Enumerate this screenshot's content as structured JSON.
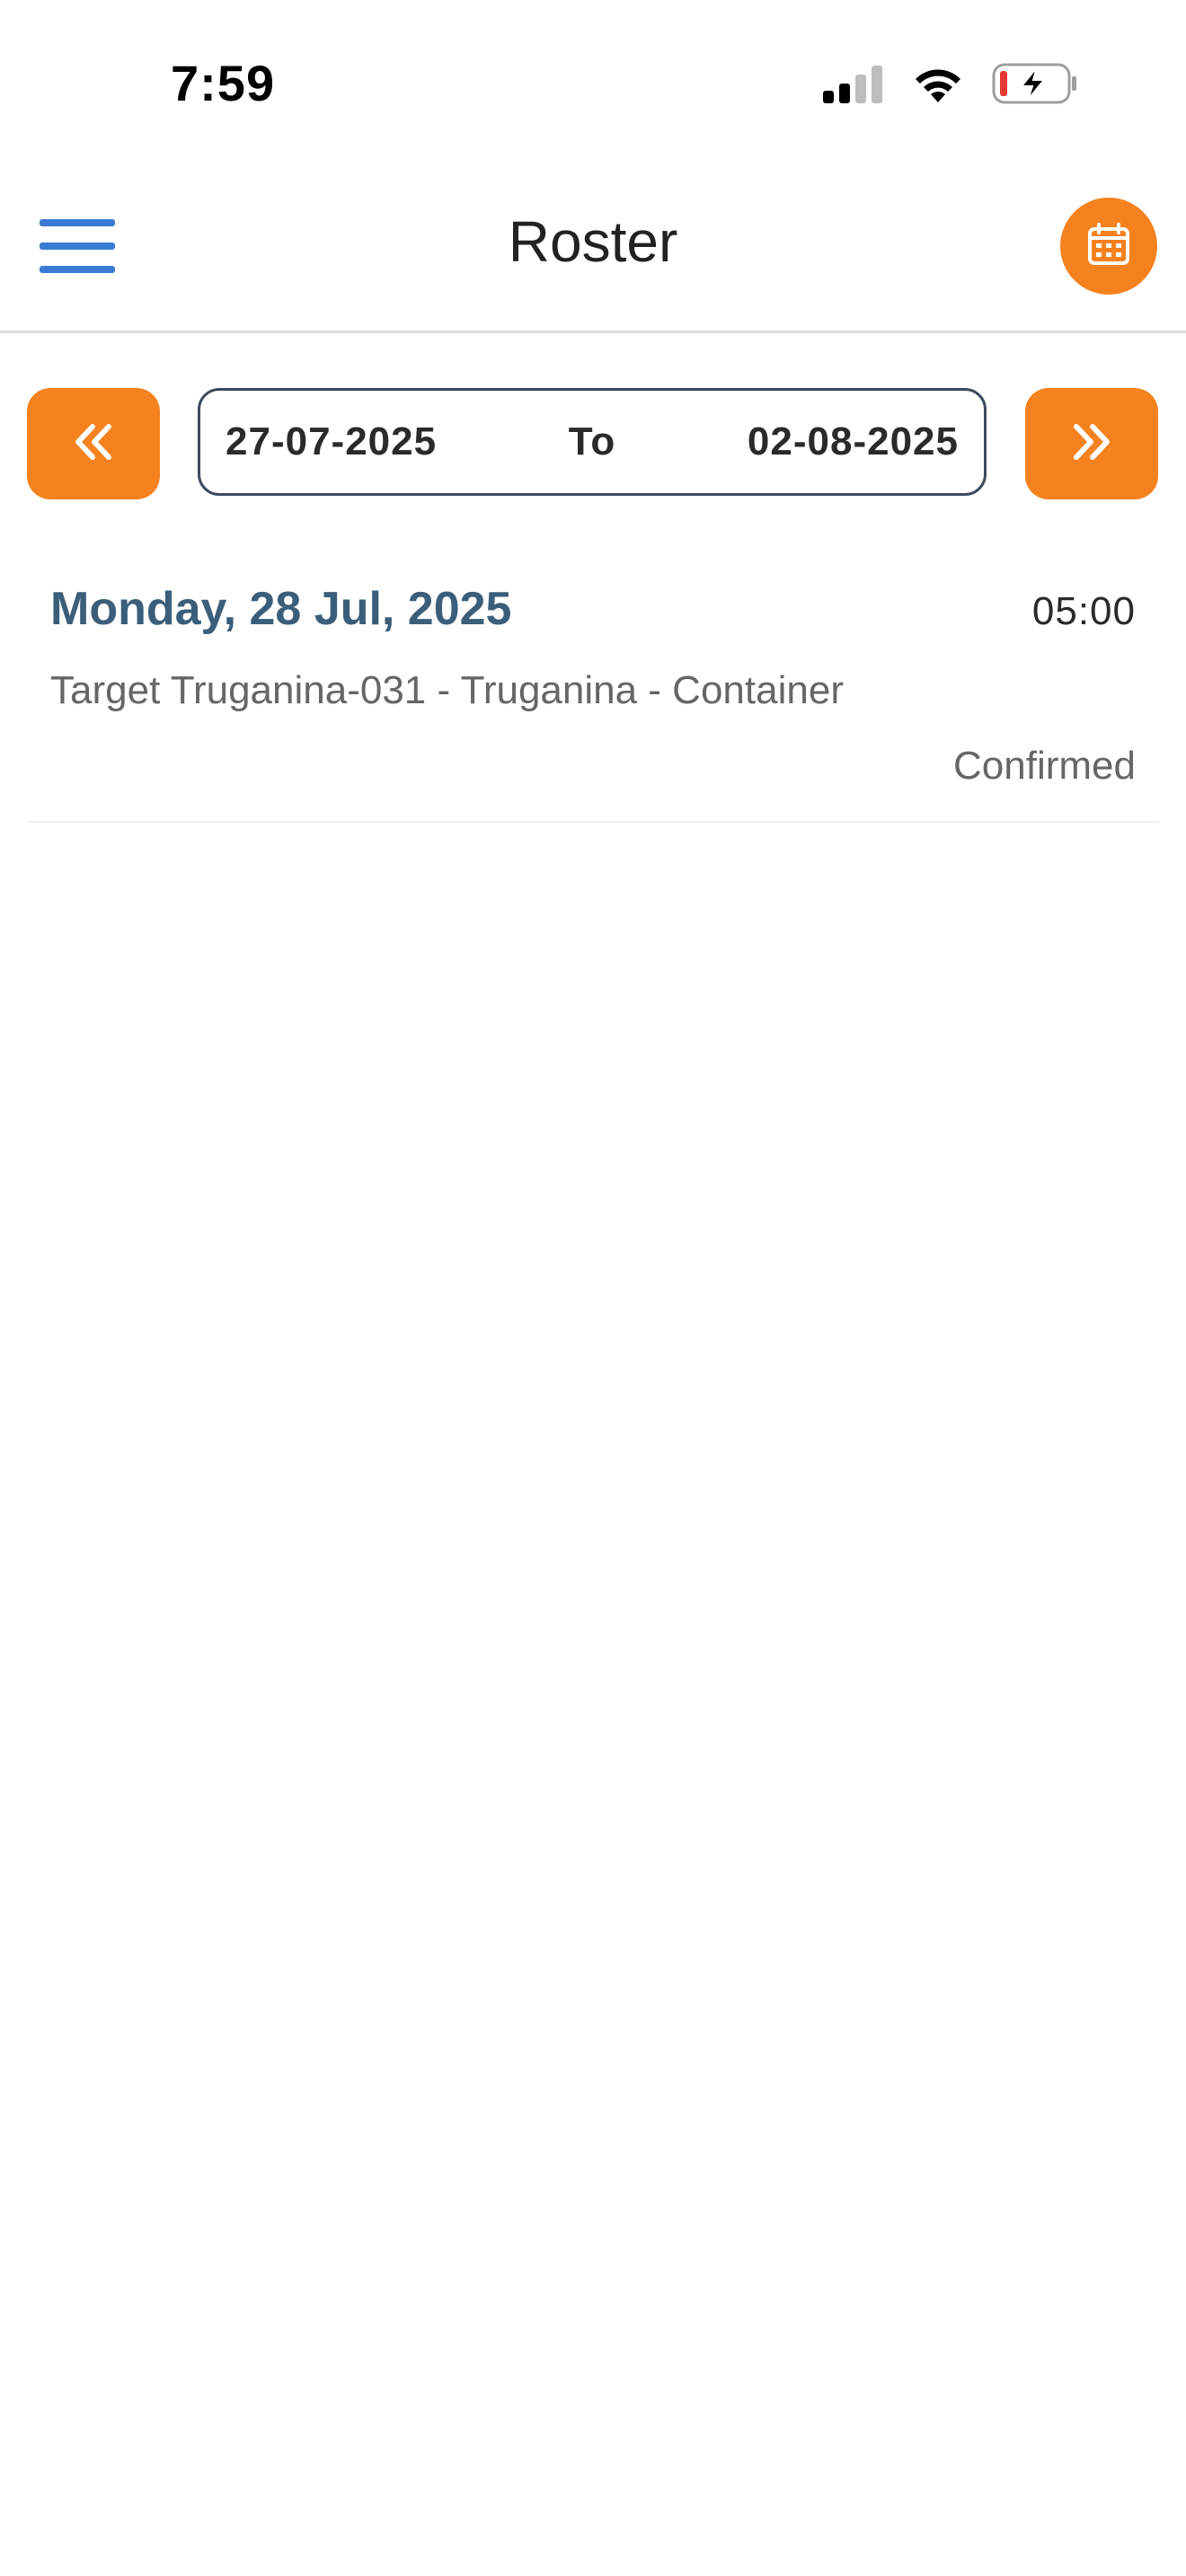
{
  "status_bar": {
    "time": "7:59",
    "icons": [
      "cellular-signal-icon",
      "wifi-icon",
      "battery-charging-icon"
    ]
  },
  "header": {
    "title": "Roster",
    "menu_icon": "hamburger-menu-icon",
    "calendar_icon": "calendar-icon"
  },
  "date_range": {
    "from": "27-07-2025",
    "separator": "To",
    "to": "02-08-2025",
    "prev_icon": "double-chevron-left-icon",
    "next_icon": "double-chevron-right-icon"
  },
  "roster": [
    {
      "date": "Monday, 28 Jul, 2025",
      "time": "05:00",
      "location": "Target Truganina-031 - Truganina - Container",
      "status": "Confirmed"
    }
  ],
  "colors": {
    "accent": "#f5821f",
    "menu": "#3a7bd5",
    "date_heading": "#3b5e7a",
    "battery_low": "#e53935"
  }
}
